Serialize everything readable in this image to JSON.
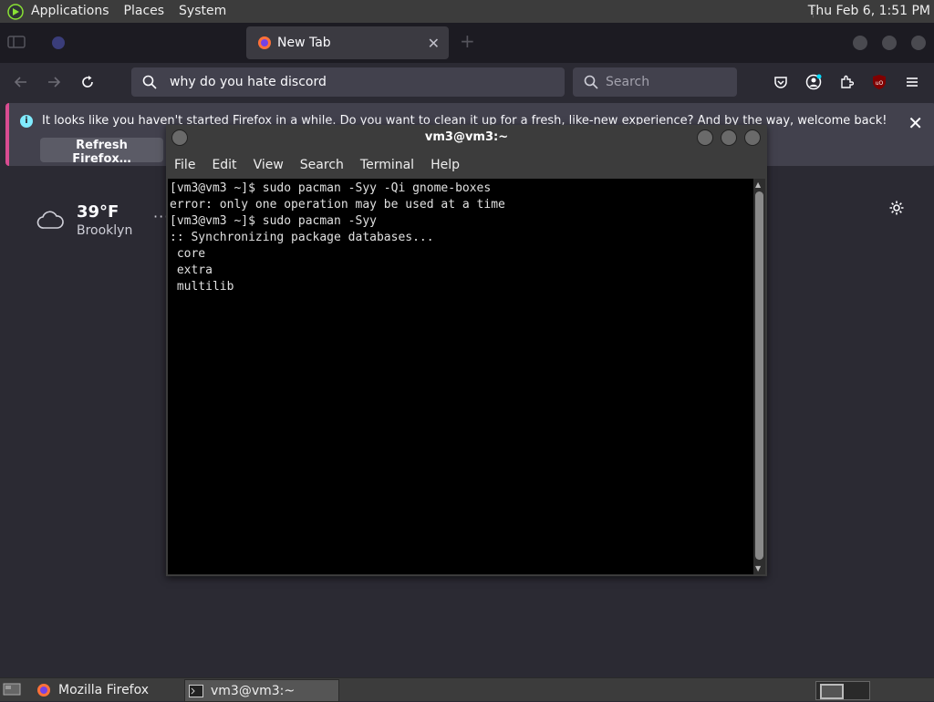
{
  "top_panel": {
    "menus": [
      "Applications",
      "Places",
      "System"
    ],
    "clock": "Thu Feb  6,  1:51 PM"
  },
  "firefox": {
    "tabs": [
      {
        "label": "",
        "active": false
      },
      {
        "label": "New Tab",
        "active": true
      }
    ],
    "url_text": "why do you hate discord",
    "search_placeholder": "Search",
    "notification": {
      "text": "It looks like you haven't started Firefox in a while. Do you want to clean it up for a fresh, like-new experience? And by the way, welcome back!",
      "button_label": "Refresh Firefox…"
    },
    "weather": {
      "temp": "39°F",
      "city": "Brooklyn"
    }
  },
  "terminal": {
    "title": "vm3@vm3:~",
    "menu": [
      "File",
      "Edit",
      "View",
      "Search",
      "Terminal",
      "Help"
    ],
    "lines": [
      "[vm3@vm3 ~]$ sudo pacman -Syy -Qi gnome-boxes",
      "error: only one operation may be used at a time",
      "[vm3@vm3 ~]$ sudo pacman -Syy",
      ":: Synchronizing package databases...",
      " core",
      " extra",
      " multilib"
    ]
  },
  "taskbar": {
    "tasks": [
      "Mozilla Firefox",
      "vm3@vm3:~"
    ]
  },
  "colors": {
    "ff_bg": "#2b2a33",
    "ff_tabstrip": "#1c1b22",
    "ff_field": "#42414d",
    "notice_accent": "#d94c91",
    "panel": "#3c3c3c",
    "terminal_bg": "#000000"
  }
}
